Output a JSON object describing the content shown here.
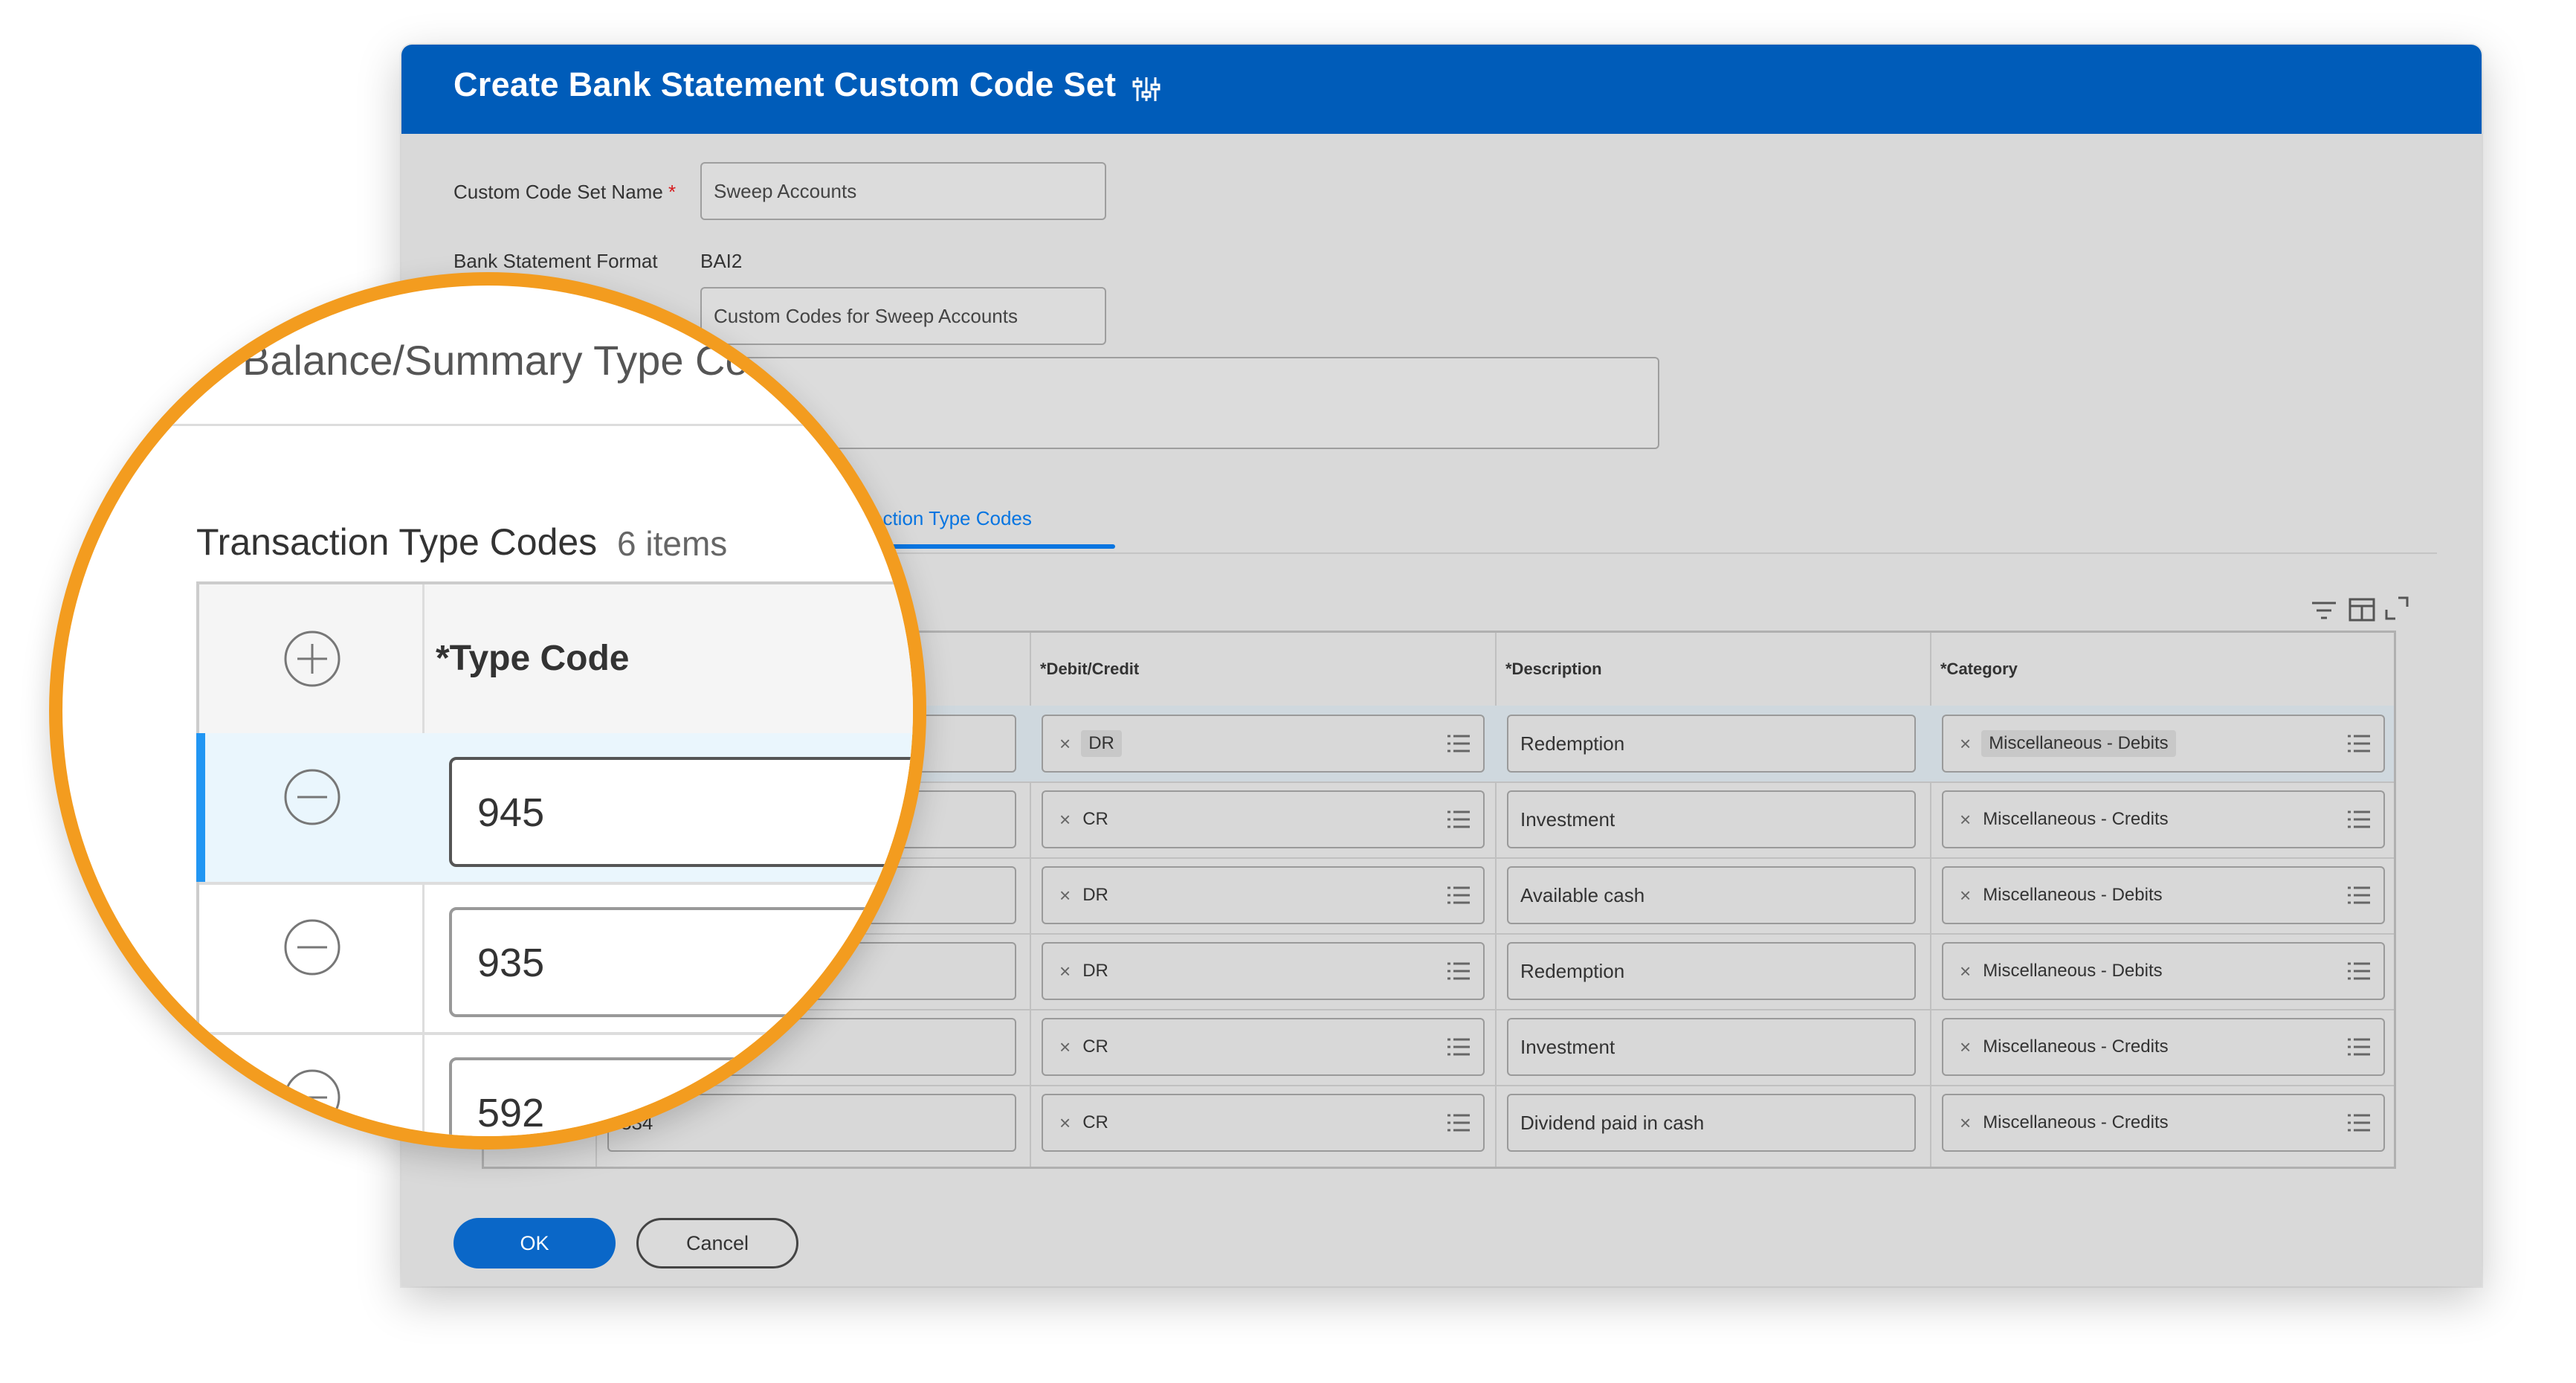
{
  "window": {
    "title": "Create Bank Statement Custom Code Set",
    "header_color": "#005cb9",
    "settings_icon": "sliders-icon"
  },
  "form": {
    "name_label": "Custom Code Set Name",
    "required_mark": "*",
    "name_value": "Sweep Accounts",
    "format_label": "Bank Statement Format",
    "format_value": "BAI2",
    "description_value": "Custom Codes for Sweep Accounts",
    "comment_value": ""
  },
  "tabs": {
    "active_visible_label": "saction Type Codes"
  },
  "grid": {
    "headers": {
      "debit_credit": "*Debit/Credit",
      "description": "*Description",
      "category": "*Category"
    },
    "tool_icons": [
      "filter-icon",
      "table-layout-icon",
      "expand-icon"
    ],
    "rows": [
      {
        "type_code": "",
        "debit_credit": "DR",
        "description": "Redemption",
        "category": "Miscellaneous - Debits",
        "selected": true
      },
      {
        "type_code": "",
        "debit_credit": "CR",
        "description": "Investment",
        "category": "Miscellaneous - Credits",
        "selected": false
      },
      {
        "type_code": "",
        "debit_credit": "DR",
        "description": "Available cash",
        "category": "Miscellaneous - Debits",
        "selected": false
      },
      {
        "type_code": "",
        "debit_credit": "DR",
        "description": "Redemption",
        "category": "Miscellaneous - Debits",
        "selected": false
      },
      {
        "type_code": "",
        "debit_credit": "CR",
        "description": "Investment",
        "category": "Miscellaneous - Credits",
        "selected": false
      },
      {
        "type_code": "334",
        "debit_credit": "CR",
        "description": "Dividend paid in cash",
        "category": "Miscellaneous - Credits",
        "selected": false
      }
    ]
  },
  "buttons": {
    "ok": "OK",
    "cancel": "Cancel",
    "ok_color": "#0a67c8"
  },
  "magnifier": {
    "ring_color": "#f39c1f",
    "section_heading": "Balance/Summary Type Co",
    "table_title": "Transaction Type Codes",
    "item_count": "6 items",
    "column_header": "*Type Code",
    "rows": [
      "945",
      "935",
      "592"
    ]
  }
}
